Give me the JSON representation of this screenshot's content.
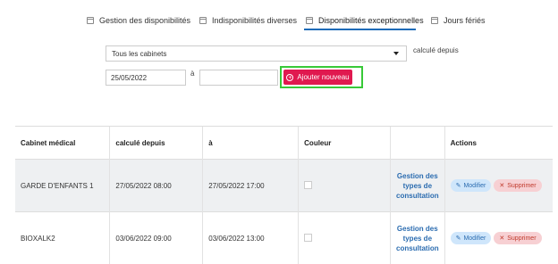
{
  "tabs": [
    {
      "label": "Gestion des disponibilités"
    },
    {
      "label": "Indisponibilités diverses"
    },
    {
      "label": "Disponibilités exceptionnelles"
    },
    {
      "label": "Jours fériés"
    }
  ],
  "filter": {
    "cabinet_select": "Tous les cabinets",
    "calc_label": "calculé depuis",
    "from_value": "25/05/2022",
    "a_label": "à",
    "to_value": "",
    "add_button": "Ajouter nouveau"
  },
  "table": {
    "headers": [
      "Cabinet médical",
      "calculé depuis",
      "à",
      "Couleur",
      "",
      "Actions"
    ],
    "rows": [
      {
        "cabinet": "GARDE D'ENFANTS 1",
        "from": "27/05/2022 08:00",
        "to": "27/05/2022 17:00",
        "link": "Gestion des types de consultation",
        "edit": "Modifier",
        "delete": "Supprimer"
      },
      {
        "cabinet": "BIOXALK2",
        "from": "03/06/2022 09:00",
        "to": "03/06/2022 13:00",
        "link": "Gestion des types de consultation",
        "edit": "Modifier",
        "delete": "Supprimer"
      }
    ]
  },
  "colors": {
    "accent": "#e0194f",
    "highlight": "#38c938",
    "link": "#2b6cb0"
  }
}
